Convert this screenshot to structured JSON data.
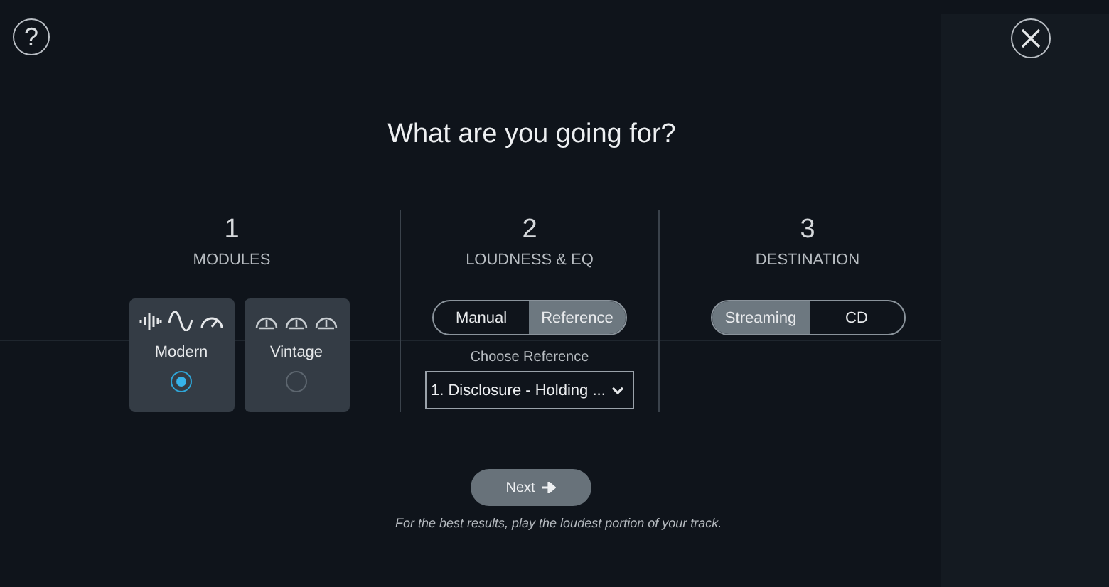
{
  "help_button": "?",
  "title": "What are you going for?",
  "steps": [
    {
      "number": "1",
      "label": "MODULES",
      "kind": "modules",
      "options": [
        {
          "label": "Modern",
          "selected": true
        },
        {
          "label": "Vintage",
          "selected": false
        }
      ]
    },
    {
      "number": "2",
      "label": "LOUDNESS & EQ",
      "kind": "loudness",
      "segments": [
        {
          "label": "Manual",
          "selected": false
        },
        {
          "label": "Reference",
          "selected": true
        }
      ],
      "dropdown_label": "Choose Reference",
      "dropdown_value": "1. Disclosure - Holding ..."
    },
    {
      "number": "3",
      "label": "DESTINATION",
      "kind": "destination",
      "segments": [
        {
          "label": "Streaming",
          "selected": true
        },
        {
          "label": "CD",
          "selected": false
        }
      ]
    }
  ],
  "next_button": "Next",
  "hint": "For the best results, play the loudest portion of your track."
}
